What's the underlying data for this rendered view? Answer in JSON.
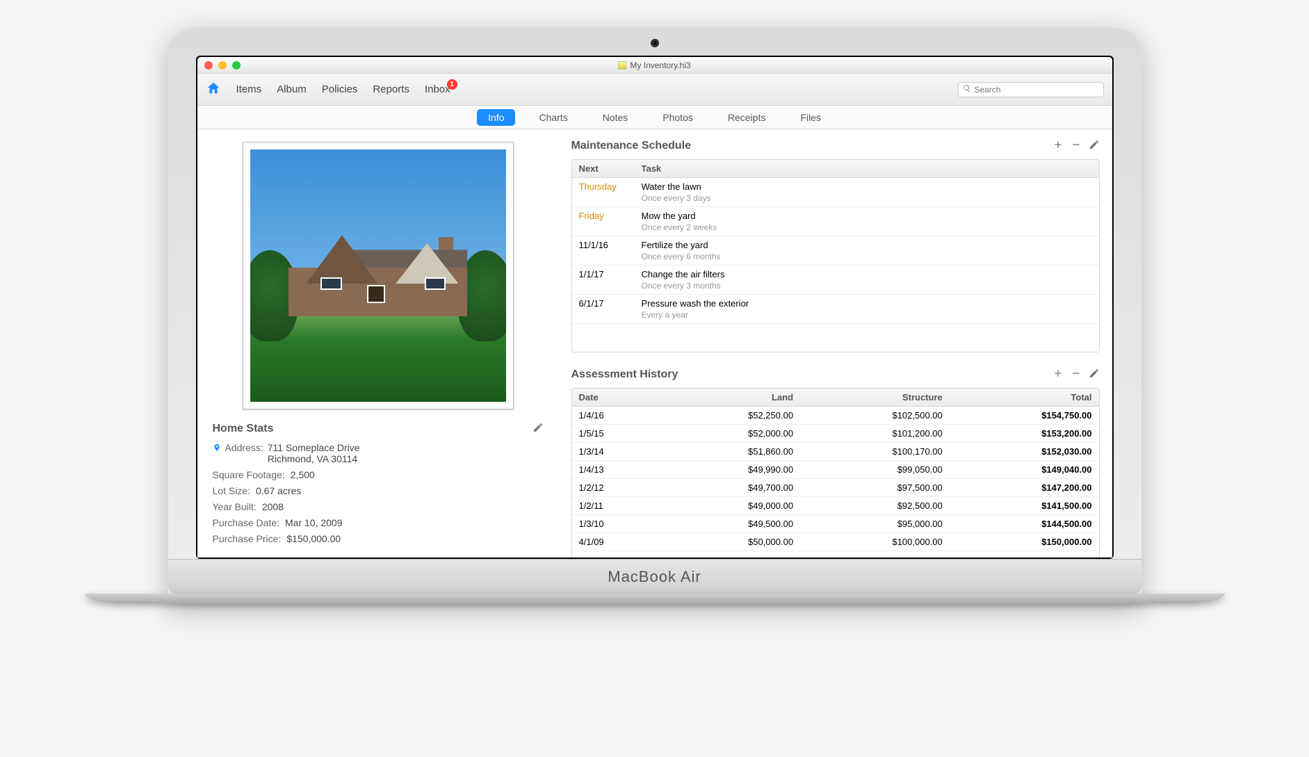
{
  "window": {
    "title": "My Inventory.hi3"
  },
  "toolbar": {
    "items": [
      "Items",
      "Album",
      "Policies",
      "Reports",
      "Inbox"
    ],
    "inbox_badge": "1",
    "search_placeholder": "Search"
  },
  "tabs": {
    "items": [
      "Info",
      "Charts",
      "Notes",
      "Photos",
      "Receipts",
      "Files"
    ],
    "active": "Info"
  },
  "homeStats": {
    "heading": "Home Stats",
    "address_label": "Address:",
    "address_line1": "711 Someplace Drive",
    "address_line2": "Richmond, VA 30114",
    "sqft_label": "Square Footage:",
    "sqft_value": "2,500",
    "lot_label": "Lot Size:",
    "lot_value": "0.67 acres",
    "year_label": "Year Built:",
    "year_value": "2008",
    "purchase_date_label": "Purchase Date:",
    "purchase_date_value": "Mar 10, 2009",
    "purchase_price_label": "Purchase Price:",
    "purchase_price_value": "$150,000.00"
  },
  "maintenance": {
    "heading": "Maintenance Schedule",
    "col_next": "Next",
    "col_task": "Task",
    "rows": [
      {
        "next": "Thursday",
        "soon": true,
        "task": "Water the lawn",
        "freq": "Once every 3 days"
      },
      {
        "next": "Friday",
        "soon": true,
        "task": "Mow the yard",
        "freq": "Once every 2 weeks"
      },
      {
        "next": "11/1/16",
        "soon": false,
        "task": "Fertilize the yard",
        "freq": "Once every 6 months"
      },
      {
        "next": "1/1/17",
        "soon": false,
        "task": "Change the air filters",
        "freq": "Once every 3 months"
      },
      {
        "next": "6/1/17",
        "soon": false,
        "task": "Pressure wash the exterior",
        "freq": "Every a year"
      }
    ]
  },
  "assessment": {
    "heading": "Assessment History",
    "col_date": "Date",
    "col_land": "Land",
    "col_structure": "Structure",
    "col_total": "Total",
    "rows": [
      {
        "date": "1/4/16",
        "land": "$52,250.00",
        "structure": "$102,500.00",
        "total": "$154,750.00"
      },
      {
        "date": "1/5/15",
        "land": "$52,000.00",
        "structure": "$101,200.00",
        "total": "$153,200.00"
      },
      {
        "date": "1/3/14",
        "land": "$51,860.00",
        "structure": "$100,170.00",
        "total": "$152,030.00"
      },
      {
        "date": "1/4/13",
        "land": "$49,990.00",
        "structure": "$99,050.00",
        "total": "$149,040.00"
      },
      {
        "date": "1/2/12",
        "land": "$49,700.00",
        "structure": "$97,500.00",
        "total": "$147,200.00"
      },
      {
        "date": "1/2/11",
        "land": "$49,000.00",
        "structure": "$92,500.00",
        "total": "$141,500.00"
      },
      {
        "date": "1/3/10",
        "land": "$49,500.00",
        "structure": "$95,000.00",
        "total": "$144,500.00"
      },
      {
        "date": "4/1/09",
        "land": "$50,000.00",
        "structure": "$100,000.00",
        "total": "$150,000.00"
      }
    ]
  },
  "device_label": "MacBook Air"
}
